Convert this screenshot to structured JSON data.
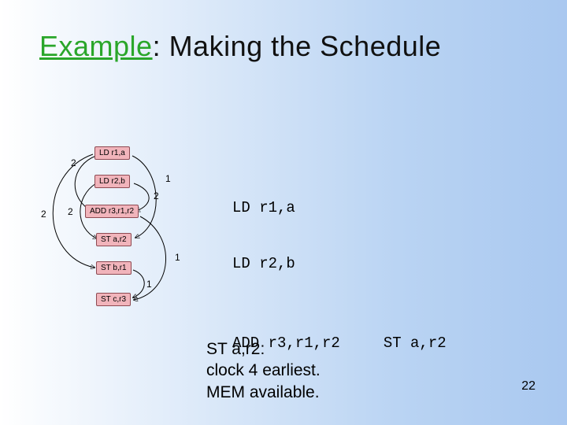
{
  "title": {
    "example": "Example",
    "rest": ": Making the Schedule"
  },
  "schedule": {
    "line1": "LD r1,a",
    "line2": "LD r2,b",
    "line3a": "ADD r3,r1,r2",
    "line3b": "ST a,r2"
  },
  "caption": {
    "l1": "ST a,r2:",
    "l2": "clock 4 earliest.",
    "l3": "MEM available."
  },
  "page_number": "22",
  "diagram": {
    "nodes": {
      "n1": "LD r1,a",
      "n2": "LD r2,b",
      "n3": "ADD r3,r1,r2",
      "n4": "ST a,r2",
      "n5": "ST b,r1",
      "n6": "ST c,r3"
    },
    "edge_labels": {
      "e_n1_n3": "2",
      "e_n1_n4": "1",
      "e_n1_n5": "2",
      "e_n2_n3": "2",
      "e_n2_n4": "2",
      "e_n3_n6": "1",
      "e_n5_n6": "1"
    }
  }
}
